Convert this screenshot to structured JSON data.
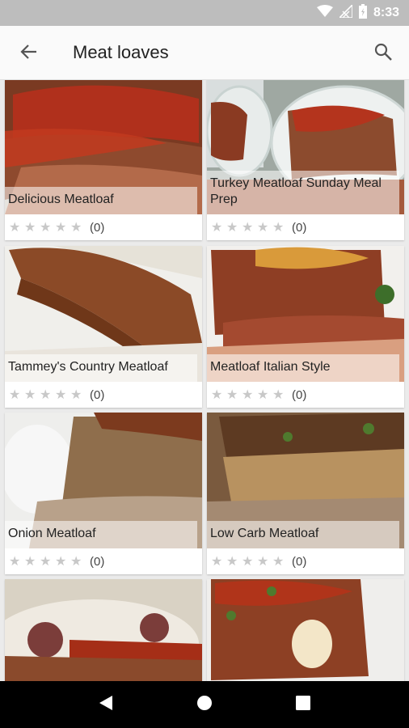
{
  "status": {
    "time": "8:33",
    "icons": [
      "wifi-icon",
      "signal-icon",
      "battery-icon"
    ]
  },
  "app_bar": {
    "title": "Meat loaves",
    "back_icon": "arrow-back-icon",
    "search_icon": "search-icon"
  },
  "recipes": [
    {
      "title": "Delicious Meatloaf",
      "rating": 0,
      "count": "(0)"
    },
    {
      "title": "Turkey Meatloaf Sunday Meal Prep",
      "rating": 0,
      "count": "(0)"
    },
    {
      "title": "Tammey's Country Meatloaf",
      "rating": 0,
      "count": "(0)"
    },
    {
      "title": "Meatloaf Italian Style",
      "rating": 0,
      "count": "(0)"
    },
    {
      "title": "Onion Meatloaf",
      "rating": 0,
      "count": "(0)"
    },
    {
      "title": "Low Carb Meatloaf",
      "rating": 0,
      "count": "(0)"
    },
    {
      "title": "",
      "rating": 0,
      "count": ""
    },
    {
      "title": "",
      "rating": 0,
      "count": ""
    }
  ],
  "nav_bar": {
    "icons": [
      "back-triangle-icon",
      "home-circle-icon",
      "recents-square-icon"
    ]
  },
  "colors": {
    "status_bar": "#bdbdbd",
    "app_bar": "#fafafa",
    "background": "#ebebeb",
    "nav_bar": "#000000",
    "star": "#c8c8c8"
  }
}
